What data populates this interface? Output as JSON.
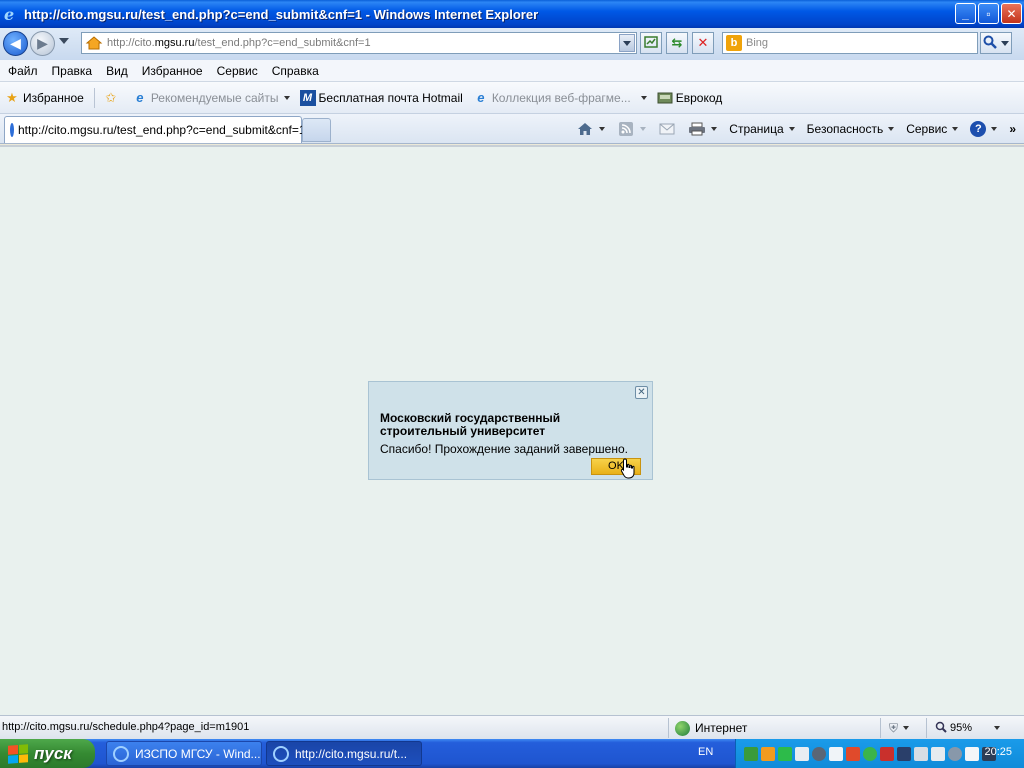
{
  "window": {
    "title": "http://cito.mgsu.ru/test_end.php?c=end_submit&cnf=1 - Windows Internet Explorer",
    "controls": {
      "minimize": "_",
      "maximize": "▫",
      "close": "✕"
    }
  },
  "address_bar": {
    "url_prefix": "http://cito.",
    "url_domain": "mgsu.ru",
    "url_suffix": "/test_end.php?c=end_submit&cnf=1"
  },
  "search": {
    "placeholder": "Bing",
    "engine_letter": "b"
  },
  "menu": [
    "Файл",
    "Правка",
    "Вид",
    "Избранное",
    "Сервис",
    "Справка"
  ],
  "favorites_bar": {
    "favorites_label": "Избранное",
    "items": [
      {
        "label": "Рекомендуемые сайты",
        "disabled": true,
        "dropdown": true
      },
      {
        "label": "Бесплатная почта Hotmail",
        "disabled": false,
        "dropdown": false
      },
      {
        "label": "Коллекция веб-фрагме...",
        "disabled": true,
        "dropdown": true
      },
      {
        "label": "Еврокод",
        "disabled": false,
        "dropdown": false
      }
    ]
  },
  "tabs": [
    {
      "label": "http://cito.mgsu.ru/test_end.php?c=end_submit&cnf=1",
      "active": true
    }
  ],
  "command_bar": {
    "page": "Страница",
    "safety": "Безопасность",
    "tools": "Сервис",
    "help": "?"
  },
  "dialog": {
    "organization": "Московский государственный строительный университет",
    "message": "Спасибо! Прохождение заданий завершено.",
    "ok_label": "OK"
  },
  "status_bar": {
    "text": "http://cito.mgsu.ru/schedule.php4?page_id=m1901",
    "zone": "Интернет",
    "zoom": "95%"
  },
  "taskbar": {
    "start_label": "пуск",
    "tasks": [
      {
        "label": "ИЗСПО МГСУ - Wind...",
        "active": false
      },
      {
        "label": "http://cito.mgsu.ru/t...",
        "active": true
      }
    ],
    "language": "EN",
    "clock": "20:25"
  },
  "colors": {
    "content_bg": "#e9f1ee",
    "dialog_bg": "#cfe1e9",
    "ok_button": "#f0c030",
    "titlebar": "#0058e6",
    "start_button": "#358a32"
  }
}
